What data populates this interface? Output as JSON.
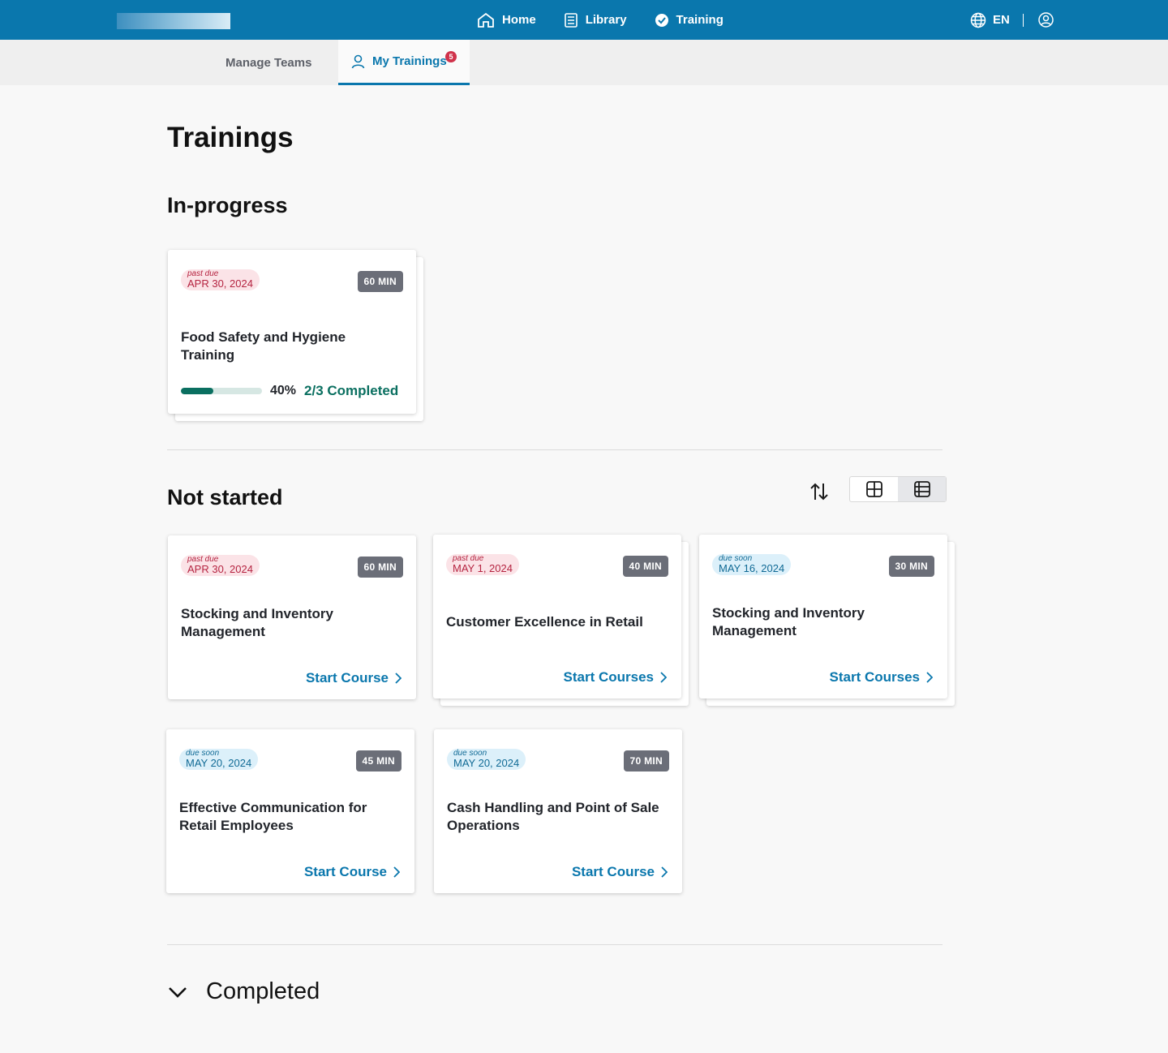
{
  "nav": {
    "links": [
      {
        "label": "Home",
        "icon": "home-icon"
      },
      {
        "label": "Library",
        "icon": "library-icon"
      },
      {
        "label": "Training",
        "icon": "check-badge-icon"
      }
    ],
    "language": "EN"
  },
  "tabs": {
    "manage_teams": "Manage Teams",
    "my_trainings": "My Trainings",
    "my_trainings_badge": "5"
  },
  "page_title": "Trainings",
  "sections": {
    "in_progress": "In-progress",
    "not_started": "Not started",
    "completed": "Completed"
  },
  "in_progress": [
    {
      "due_label": "past due",
      "due_date": "APR 30, 2024",
      "duration": "60 MIN",
      "title": "Food Safety and Hygiene Training",
      "progress_pct_value": 0.4,
      "progress_pct": "40%",
      "progress_text": "2/3 Completed"
    }
  ],
  "not_started": [
    {
      "due_label": "past due",
      "due_date": "APR 30, 2024",
      "duration": "60 MIN",
      "title": "Stocking and Inventory Management",
      "cta": "Start Course"
    },
    {
      "due_label": "past due",
      "due_date": "MAY 1, 2024",
      "duration": "40 MIN",
      "title": "Customer Excellence in Retail",
      "cta": "Start Courses"
    },
    {
      "due_label": "due soon",
      "due_date": "MAY 16, 2024",
      "duration": "30 MIN",
      "title": "Stocking and Inventory Management",
      "cta": "Start Courses"
    },
    {
      "due_label": "due soon",
      "due_date": "MAY 20, 2024",
      "duration": "45 MIN",
      "title": "Effective Communication for Retail Employees",
      "cta": "Start Course"
    },
    {
      "due_label": "due soon",
      "due_date": "MAY 20, 2024",
      "duration": "70 MIN",
      "title": "Cash Handling and Point of Sale Operations",
      "cta": "Start Course"
    }
  ],
  "colors": {
    "primary": "#0a77ad",
    "past_due": "#b52441",
    "due_soon": "#106a95",
    "progress": "#0a6f60"
  }
}
